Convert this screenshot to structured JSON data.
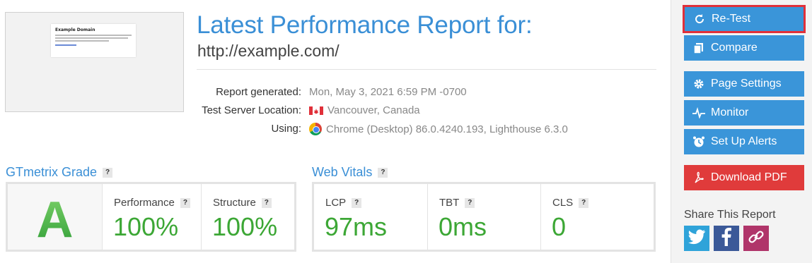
{
  "thumbnail": {
    "title": "Example Domain"
  },
  "report": {
    "title": "Latest Performance Report for:",
    "url": "http://example.com/"
  },
  "meta": {
    "generated_label": "Report generated:",
    "generated_value": "Mon, May 3, 2021 6:59 PM -0700",
    "location_label": "Test Server Location:",
    "location_value": "Vancouver, Canada",
    "using_label": "Using:",
    "using_value": "Chrome (Desktop) 86.0.4240.193, Lighthouse 6.3.0"
  },
  "gtmetrix": {
    "heading": "GTmetrix Grade",
    "help": "?",
    "grade": "A",
    "performance_label": "Performance",
    "performance_value": "100%",
    "structure_label": "Structure",
    "structure_value": "100%"
  },
  "vitals": {
    "heading": "Web Vitals",
    "help": "?",
    "lcp_label": "LCP",
    "lcp_value": "97ms",
    "tbt_label": "TBT",
    "tbt_value": "0ms",
    "cls_label": "CLS",
    "cls_value": "0"
  },
  "sidebar": {
    "retest": "Re-Test",
    "compare": "Compare",
    "page_settings": "Page Settings",
    "monitor": "Monitor",
    "alerts": "Set Up Alerts",
    "download_pdf": "Download PDF",
    "share_title": "Share This Report"
  },
  "colors": {
    "accent": "#3a8fd6",
    "button": "#3a95d9",
    "pdf": "#e03b3b",
    "good": "#3ca735",
    "twitter": "#2fa3d9",
    "facebook": "#3b5998",
    "link": "#b0356a"
  },
  "icons": {
    "retest": "refresh-icon",
    "compare": "copy-icon",
    "page_settings": "gear-icon",
    "monitor": "pulse-icon",
    "alerts": "alarm-clock-icon",
    "download_pdf": "pdf-icon",
    "twitter": "twitter-icon",
    "facebook": "facebook-icon",
    "link": "link-icon"
  }
}
